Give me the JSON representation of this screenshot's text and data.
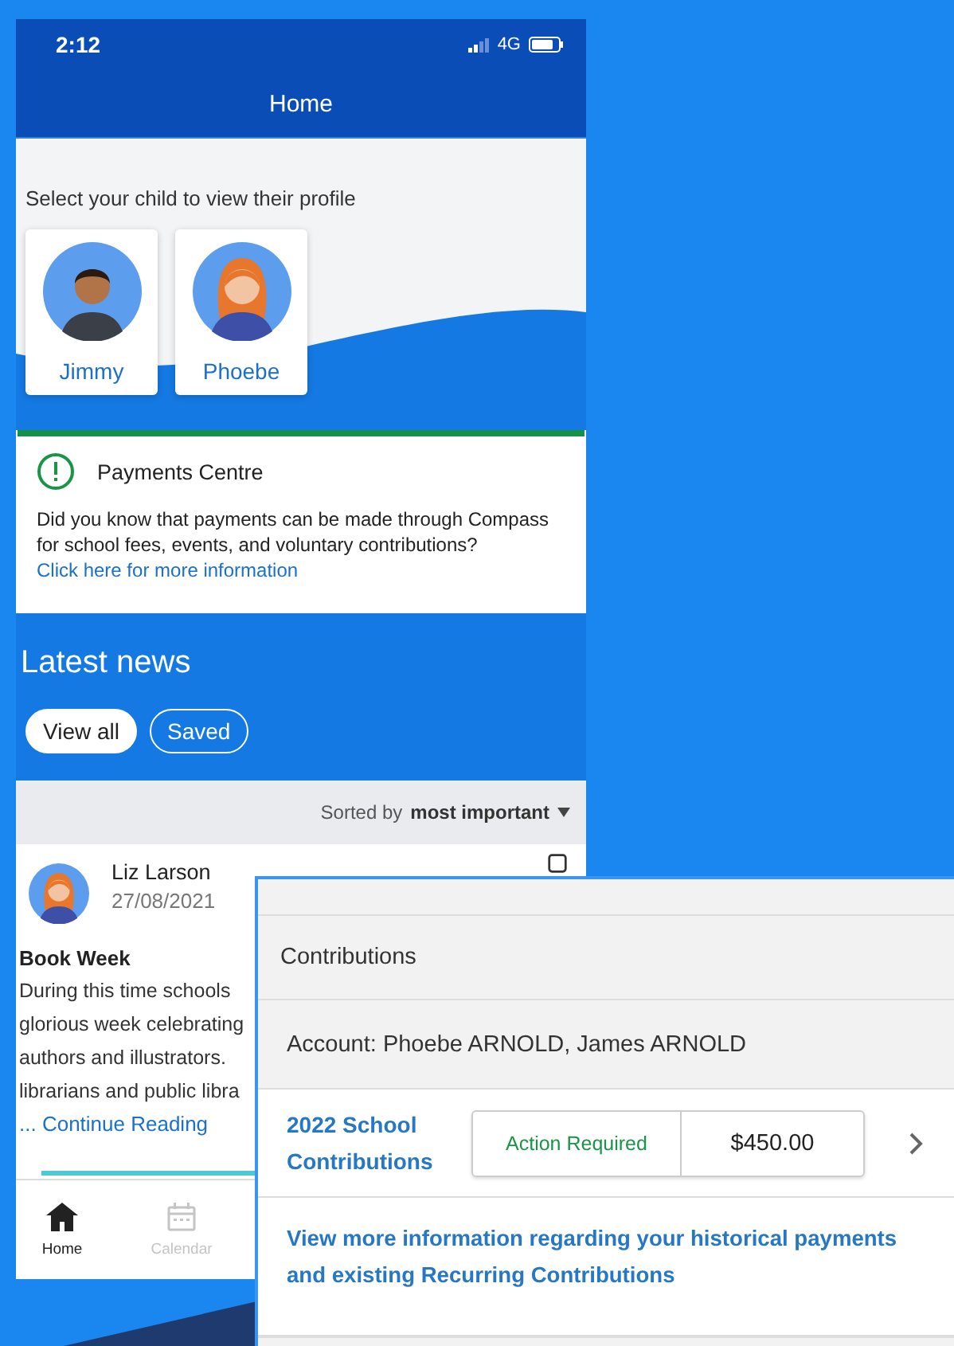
{
  "status_bar": {
    "time": "2:12",
    "network": "4G"
  },
  "header": {
    "title": "Home"
  },
  "children_section": {
    "prompt": "Select your child to view their profile",
    "children": [
      {
        "name": "Jimmy",
        "kind": "boy"
      },
      {
        "name": "Phoebe",
        "kind": "girl"
      }
    ]
  },
  "payments_card": {
    "title": "Payments Centre",
    "text": "Did you know that payments can be made through Compass for school fees, events, and voluntary contributions?",
    "link": "Click here for more information"
  },
  "latest_news": {
    "title": "Latest news",
    "filters": [
      {
        "label": "View all",
        "selected": true
      },
      {
        "label": "Saved",
        "selected": false
      }
    ],
    "sort_label": "Sorted by",
    "sort_value": "most important",
    "post": {
      "author": "Liz Larson",
      "date": "27/08/2021",
      "title": "Book Week",
      "body_lines": [
        "During this time schools",
        "glorious week celebrating",
        "authors and illustrators.",
        "librarians and public libra"
      ],
      "more_link": "... Continue Reading"
    }
  },
  "bottom_nav": [
    {
      "label": "Home",
      "kind": "home",
      "selected": true
    },
    {
      "label": "Calendar",
      "kind": "calendar",
      "selected": false
    }
  ],
  "contributions_panel": {
    "title": "Contributions",
    "account": "Account: Phoebe ARNOLD, James ARNOLD",
    "items": [
      {
        "name": "2022 School Contributions",
        "status": "Action Required",
        "amount": "$450.00"
      }
    ],
    "history_link": "View more information regarding your historical payments and existing Recurring Contributions"
  }
}
